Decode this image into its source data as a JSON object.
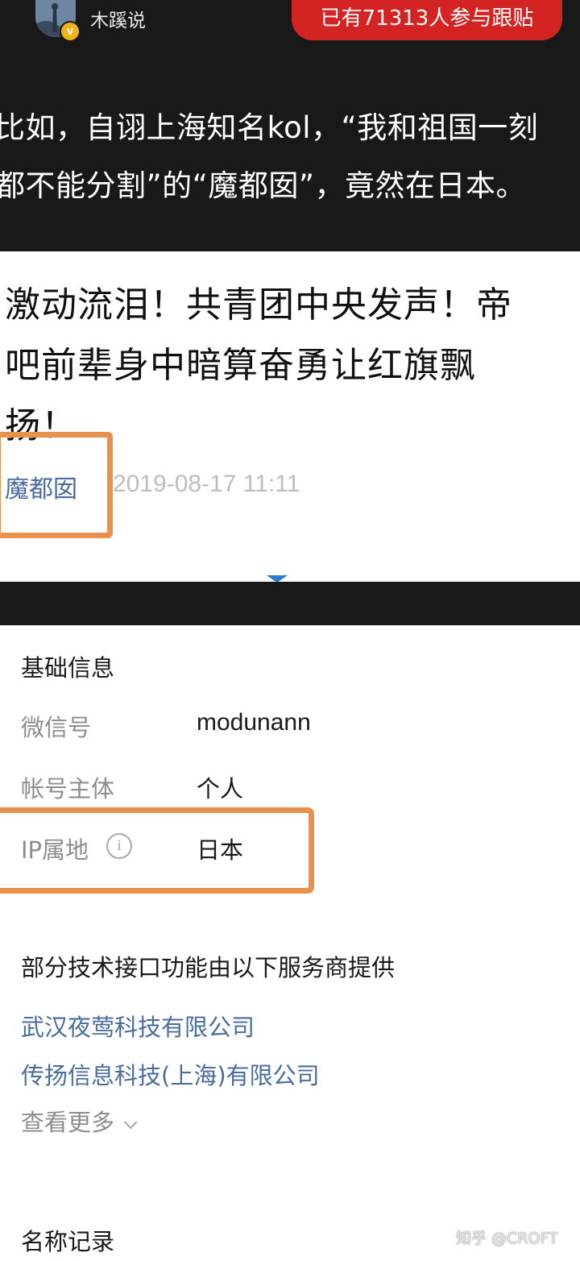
{
  "header": {
    "username": "木蹊说",
    "follow_pill": "已有71313人参与跟贴",
    "verified_badge": "v"
  },
  "intro_text": {
    "line1": "比如，自诩上海知名kol，“我和祖国一刻",
    "line2": "都不能分割”的“魔都囡”，竟然在日本。"
  },
  "article": {
    "title_line1": "激动流泪！共青团中央发声！帝",
    "title_line2": "吧前辈身中暗算奋勇让红旗飘",
    "title_line3": "扬！",
    "author": "魔都囡",
    "date": "2019-08-17 11:11"
  },
  "account_info": {
    "section_title": "基础信息",
    "rows": [
      {
        "label": "微信号",
        "value": "modunann"
      },
      {
        "label": "帐号主体",
        "value": "个人"
      },
      {
        "label": "IP属地",
        "value": "日本"
      }
    ],
    "info_icon": "i"
  },
  "providers": {
    "title": "部分技术接口功能由以下服务商提供",
    "items": [
      "武汉夜莺科技有限公司",
      "传扬信息科技(上海)有限公司"
    ],
    "more_label": "查看更多"
  },
  "name_history": {
    "title": "名称记录"
  },
  "watermark": "知乎 @CROFT",
  "colors": {
    "dark_bg": "#191919",
    "pill_red": "#d32323",
    "highlight_orange": "#e8914a",
    "link_blue": "#4a6d9e",
    "badge_gold": "#f0b419"
  },
  "icons": {
    "avatar": "avatar-image",
    "badge": "verified-badge-icon",
    "info": "info-circle-icon",
    "more": "chevron-down-icon",
    "scroll": "triangle-down-icon"
  }
}
